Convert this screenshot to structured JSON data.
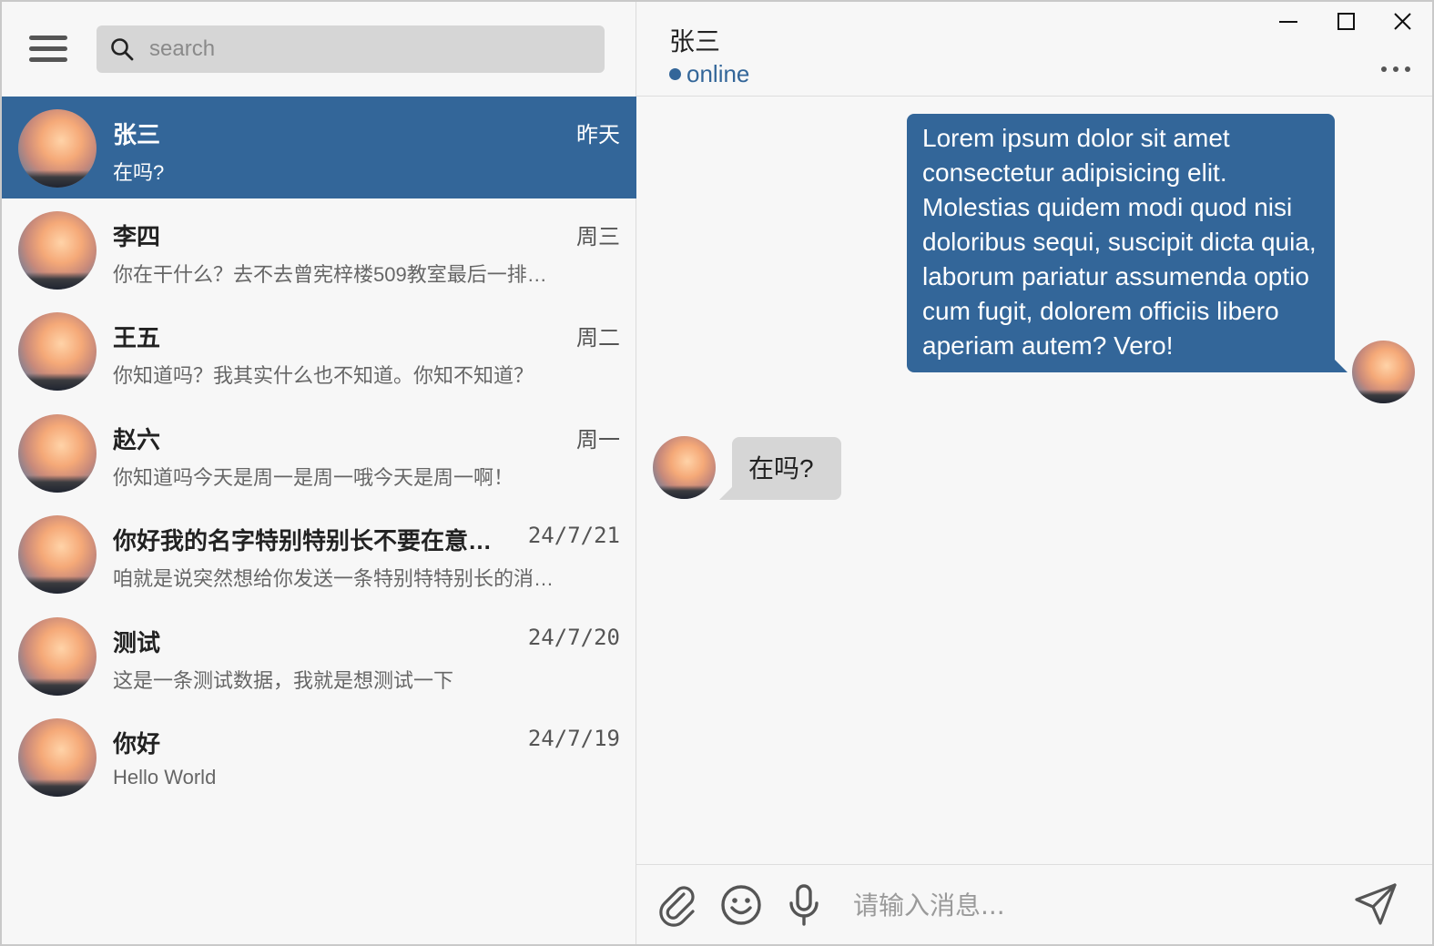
{
  "search": {
    "placeholder": "search"
  },
  "conversations": [
    {
      "name": "张三",
      "time": "昨天",
      "message": "在吗?",
      "active": true
    },
    {
      "name": "李四",
      "time": "周三",
      "message": "你在干什么？去不去曾宪梓楼509教室最后一排…"
    },
    {
      "name": "王五",
      "time": "周二",
      "message": "你知道吗？我其实什么也不知道。你知不知道？"
    },
    {
      "name": "赵六",
      "time": "周一",
      "message": "你知道吗今天是周一是周一哦今天是周一啊！"
    },
    {
      "name": "你好我的名字特别特别长不要在意…",
      "time": "24/7/21",
      "message": "咱就是说突然想给你发送一条特别特特别长的消…"
    },
    {
      "name": "测试",
      "time": "24/7/20",
      "message": "这是一条测试数据，我就是想测试一下"
    },
    {
      "name": "你好",
      "time": "24/7/19",
      "message": "Hello World"
    }
  ],
  "chat": {
    "title": "张三",
    "status": "online",
    "accent_color": "#336699",
    "messages": [
      {
        "direction": "out",
        "text": "Lorem ipsum dolor sit amet consectetur adipisicing elit. Molestias quidem modi quod nisi doloribus sequi, suscipit dicta quia, laborum pariatur assumenda optio cum fugit, dolorem officiis libero aperiam autem? Vero!"
      },
      {
        "direction": "in",
        "text": "在吗?"
      }
    ]
  },
  "composer": {
    "placeholder": "请输入消息..."
  },
  "icons": [
    "menu-icon",
    "search-icon",
    "minimize-icon",
    "maximize-icon",
    "close-icon",
    "more-icon",
    "attachment-icon",
    "emoji-icon",
    "microphone-icon",
    "send-icon"
  ]
}
